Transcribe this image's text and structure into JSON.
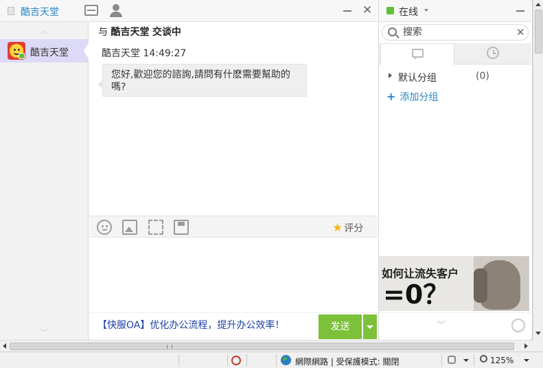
{
  "left": {
    "header_title": "酷吉天堂",
    "contact_name": "酷吉天堂"
  },
  "chat": {
    "subtitle_prefix": "与",
    "subtitle_name": "酷吉天堂",
    "subtitle_suffix": "交谈中",
    "message_sender": "酷吉天堂",
    "message_time": "14:49:27",
    "message_text": "您好,歡迎您的諮詢,請問有什麽需要幫助的嗎?",
    "rate_label": "评分",
    "promo_text": "【快服OA】优化办公流程，提升办公效率！",
    "send_label": "发送"
  },
  "right": {
    "status_label": "在线",
    "search_placeholder": "搜索",
    "group_name": "默认分组",
    "group_count": "(0)",
    "add_group": "添加分组",
    "ad_text": "如何让流失客户",
    "ad_big": "=0？"
  },
  "statusbar": {
    "zone": "網際網路 | 受保護模式: 關閉",
    "zoom": "125%"
  },
  "colors": {
    "accent_blue": "#2a86c7",
    "online_green": "#5cc137",
    "send_green": "#7dc13a",
    "promo_blue": "#1a3fa4"
  },
  "icons": [
    "doc-icon",
    "monitor-icon",
    "person-icon",
    "minimize-icon",
    "close-icon",
    "emoji-icon",
    "image-icon",
    "screenshot-icon",
    "save-icon",
    "star-icon",
    "search-icon",
    "chat-bubble-icon",
    "clock-icon",
    "refresh-icon",
    "privacy-eye-icon",
    "globe-icon",
    "lock-icon",
    "zoom-icon"
  ]
}
